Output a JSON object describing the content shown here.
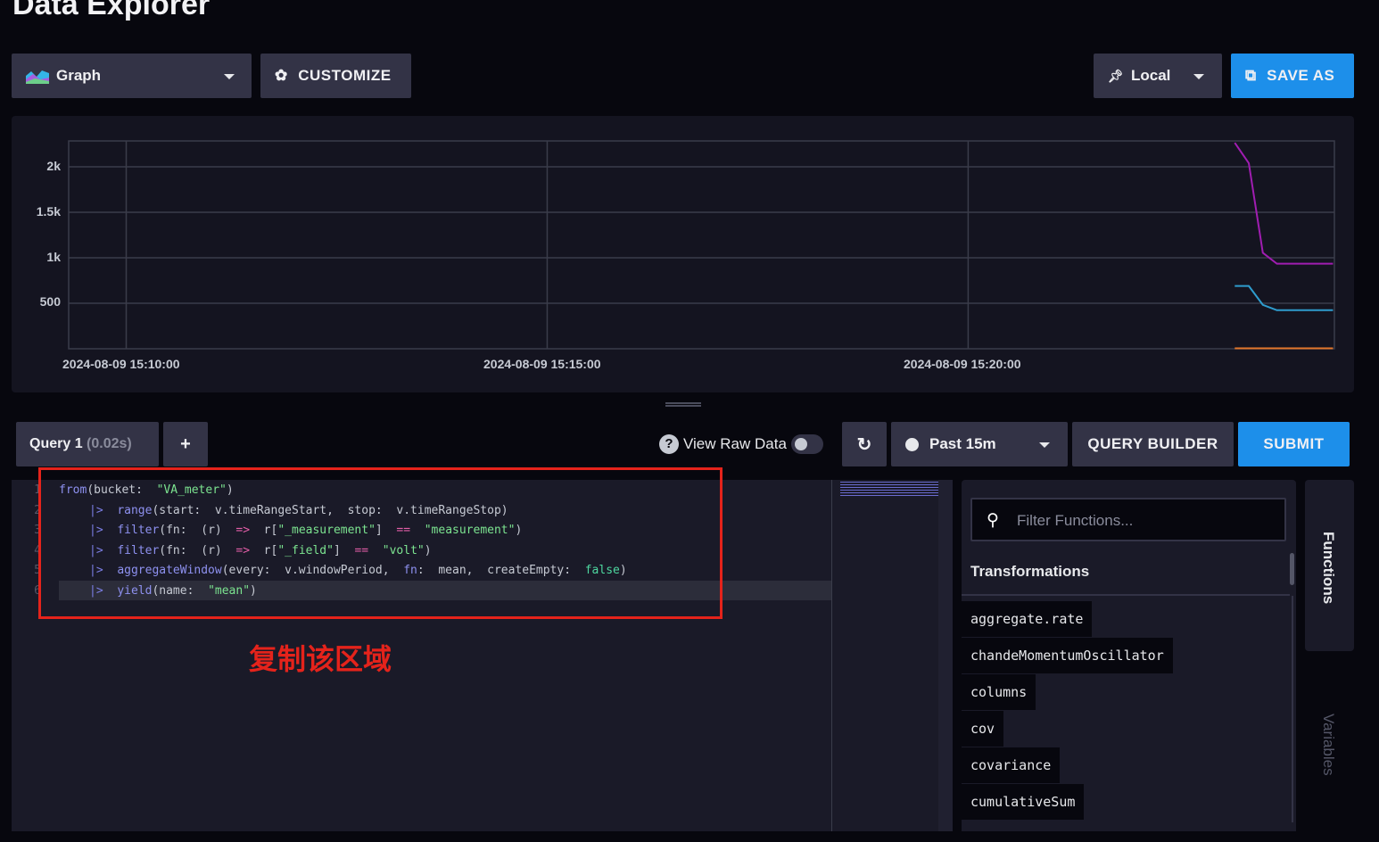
{
  "page_title": "Data Explorer",
  "toolbar": {
    "view_type": "Graph",
    "customize": "CUSTOMIZE",
    "timezone": "Local",
    "save_as": "SAVE AS"
  },
  "chart_data": {
    "type": "line",
    "x_ticks": [
      "2024-08-09 15:10:00",
      "2024-08-09 15:15:00",
      "2024-08-09 15:20:00"
    ],
    "y_ticks": [
      "500",
      "1k",
      "1.5k",
      "2k"
    ],
    "ylim": [
      0,
      2285
    ],
    "xlim": [
      "2024-08-09 15:09:19",
      "2024-08-09 15:24:21"
    ],
    "grid": true,
    "x": [
      "15:23:10",
      "15:23:20",
      "15:23:30",
      "15:23:40",
      "15:24:20"
    ],
    "series": [
      {
        "color": "#a01db1",
        "values": [
          2265,
          2040,
          1055,
          935,
          935
        ]
      },
      {
        "color": "#2e9ccd",
        "values": [
          690,
          690,
          483,
          424,
          424
        ]
      },
      {
        "color": "#e3762b",
        "values": [
          5,
          5,
          5,
          5,
          5
        ]
      }
    ]
  },
  "query": {
    "tab_label": "Query 1",
    "tab_time": "(0.02s)",
    "add": "+",
    "view_raw": "View Raw Data",
    "view_raw_on": false,
    "time_range": "Past 15m",
    "builder": "QUERY BUILDER",
    "submit": "SUBMIT",
    "lines": [
      "1",
      "2",
      "3",
      "4",
      "5",
      "6"
    ]
  },
  "code": {
    "l1": [
      "from",
      "(bucket:  ",
      "\"VA_meter\"",
      ")"
    ],
    "l2": [
      "|>",
      "range",
      "(start:  v.timeRangeStart,  stop:  v.timeRangeStop)"
    ],
    "l3": [
      "|>",
      "filter",
      "(fn:  (r)  ",
      "=>",
      "  r[",
      "\"_measurement\"",
      "]  ",
      "==",
      "  ",
      "\"measurement\"",
      ")"
    ],
    "l4": [
      "|>",
      "filter",
      "(fn:  (r)  ",
      "=>",
      "  r[",
      "\"_field\"",
      "]  ",
      "==",
      "  ",
      "\"volt\"",
      ")"
    ],
    "l5": [
      "|>",
      "aggregateWindow",
      "(every:  v.windowPeriod,  ",
      "fn",
      ":  mean,  createEmpty:  ",
      "false",
      ")"
    ],
    "l6": [
      "|>",
      "yield",
      "(name:  ",
      "\"mean\"",
      ")"
    ]
  },
  "annotation": "复制该区域",
  "functions": {
    "placeholder": "Filter Functions...",
    "section": "Transformations",
    "items": [
      "aggregate.rate",
      "chandeMomentumOscillator",
      "columns",
      "cov",
      "covariance",
      "cumulativeSum"
    ],
    "tab_functions": "Functions",
    "tab_variables": "Variables"
  },
  "colors": {
    "accent": "#1d8fea",
    "annotation": "#e5231b"
  }
}
